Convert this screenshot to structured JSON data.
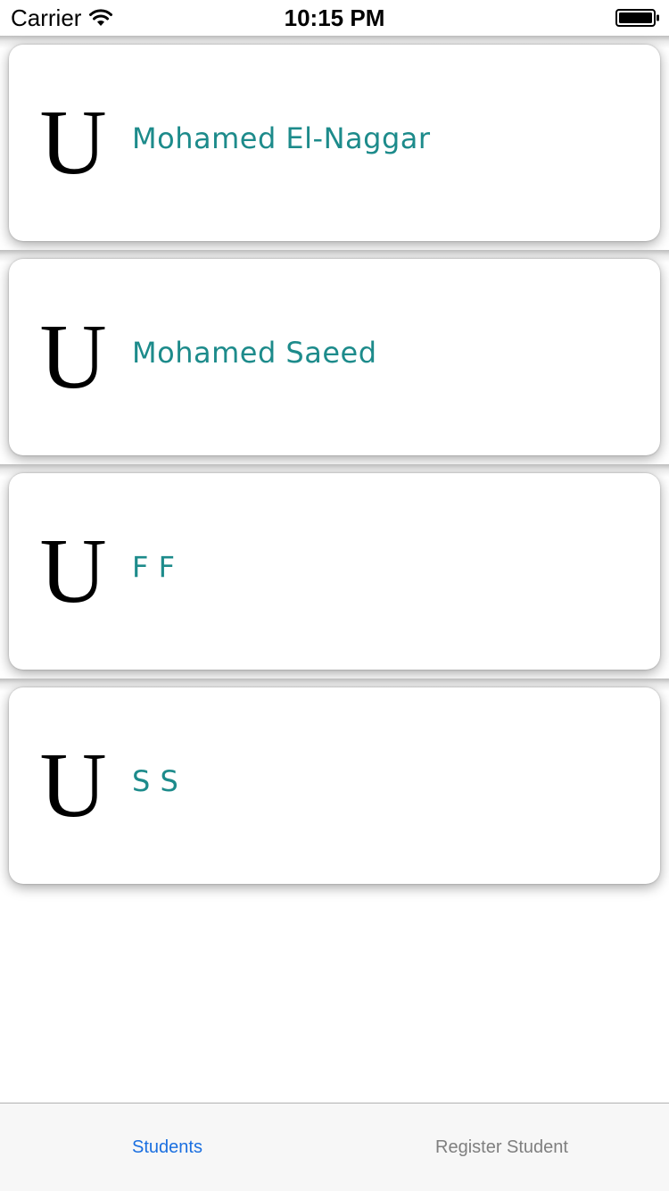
{
  "status_bar": {
    "carrier": "Carrier",
    "time": "10:15 PM",
    "wifi_icon": "wifi-icon",
    "battery_icon": "battery-icon"
  },
  "students": [
    {
      "initial": "U",
      "name": "Mohamed El-Naggar"
    },
    {
      "initial": "U",
      "name": "Mohamed Saeed"
    },
    {
      "initial": "U",
      "name": "F F"
    },
    {
      "initial": "U",
      "name": "S S"
    }
  ],
  "tabs": [
    {
      "label": "Students",
      "active": true
    },
    {
      "label": "Register Student",
      "active": false
    }
  ],
  "colors": {
    "name_text": "#1d8b8b",
    "tab_active": "#1a6fe0",
    "tab_inactive": "#7f7f7f",
    "tab_bar_bg": "#f7f7f7"
  }
}
